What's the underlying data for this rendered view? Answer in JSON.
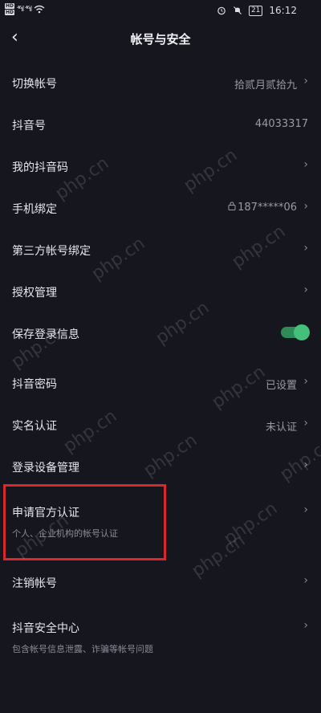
{
  "status": {
    "hd_top": "HD",
    "hd_bottom": "HD",
    "signal": "⁴⁶ıl ⁴⁶ıl",
    "battery": "21",
    "time": "16:12"
  },
  "header": {
    "back_glyph": "‹",
    "title": "帐号与安全"
  },
  "rows": [
    {
      "label": "切换帐号",
      "value": "拾贰月贰拾九"
    },
    {
      "label": "抖音号",
      "value": "44033317"
    },
    {
      "label": "我的抖音码"
    },
    {
      "label": "手机绑定",
      "value": "187*****06"
    },
    {
      "label": "第三方帐号绑定"
    },
    {
      "label": "授权管理"
    },
    {
      "label": "保存登录信息",
      "toggle_on": true
    },
    {
      "label": "抖音密码",
      "value": "已设置"
    },
    {
      "label": "实名认证",
      "value": "未认证"
    },
    {
      "label": "登录设备管理"
    },
    {
      "label": "申请官方认证",
      "sub": "个人、企业机构的帐号认证"
    },
    {
      "label": "注销帐号"
    },
    {
      "label": "抖音安全中心",
      "sub": "包含帐号信息泄露、诈骗等帐号问题"
    }
  ],
  "icons": {
    "chevron": "chevron-right-icon",
    "lock": "lock-icon",
    "back": "back-arrow-icon"
  },
  "colors": {
    "background": "#16161e",
    "toggle_on": "#43c07a",
    "highlight": "#d8282c"
  },
  "watermark": "php.cn"
}
